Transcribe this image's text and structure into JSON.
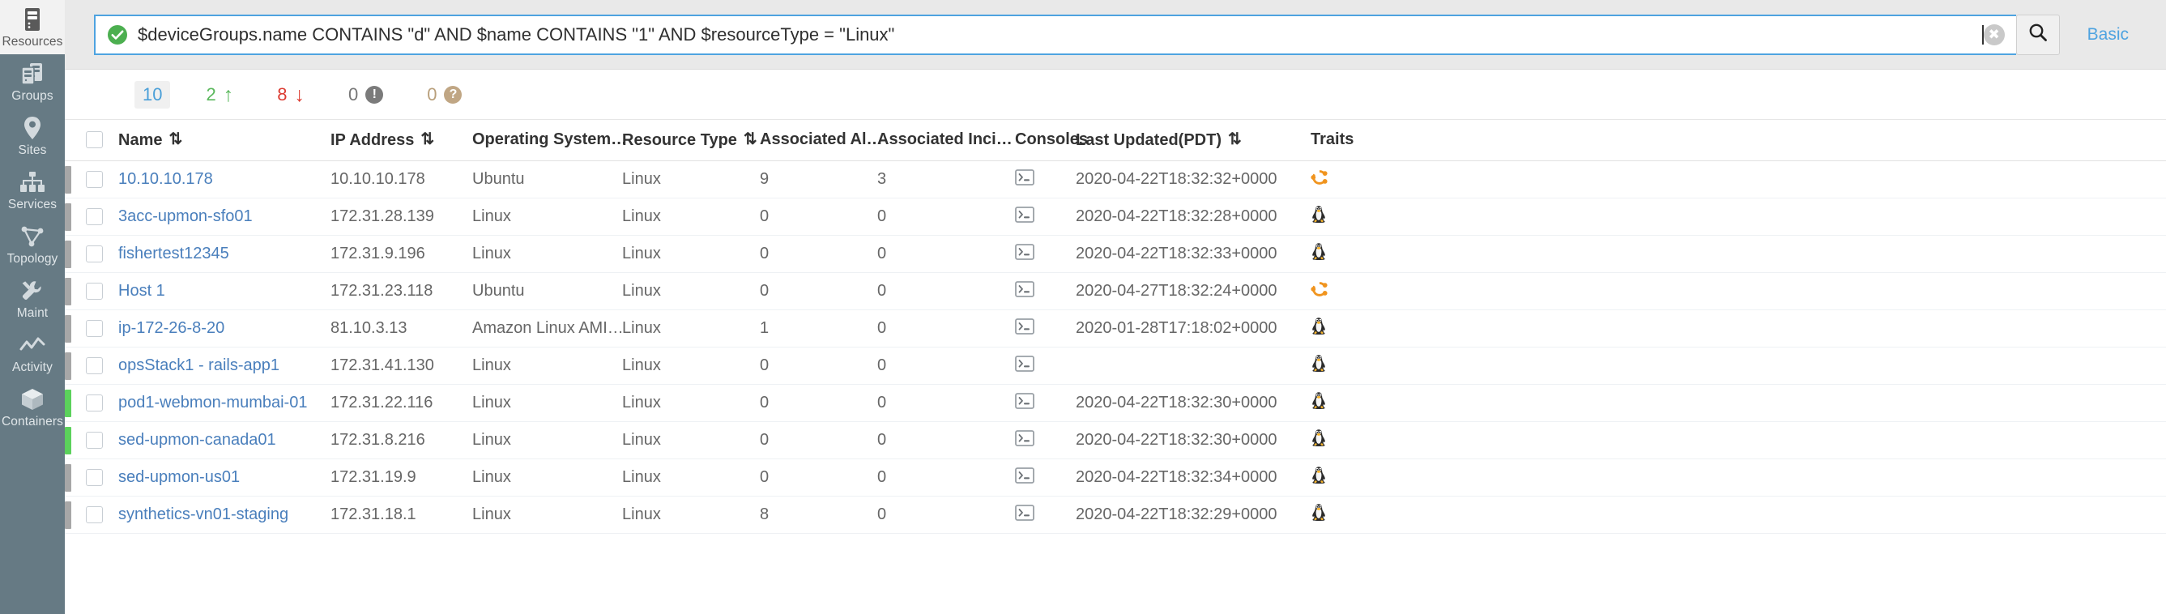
{
  "sidebar": {
    "items": [
      {
        "label": "Resources",
        "icon": "server-icon",
        "active": true
      },
      {
        "label": "Groups",
        "icon": "servers-icon",
        "active": false
      },
      {
        "label": "Sites",
        "icon": "map-pin-icon",
        "active": false
      },
      {
        "label": "Services",
        "icon": "hierarchy-icon",
        "active": false
      },
      {
        "label": "Topology",
        "icon": "topology-icon",
        "active": false
      },
      {
        "label": "Maint",
        "icon": "tools-icon",
        "active": false
      },
      {
        "label": "Activity",
        "icon": "activity-icon",
        "active": false
      },
      {
        "label": "Containers",
        "icon": "cube-icon",
        "active": false
      }
    ]
  },
  "search": {
    "query": "$deviceGroups.name CONTAINS \"d\" AND $name CONTAINS \"1\" AND $resourceType = \"Linux\"",
    "placeholder": "Search",
    "valid_icon": "green-check-icon",
    "clear_icon": "clear-x-icon",
    "search_icon": "search-icon",
    "mode_label": "Basic",
    "accent_color": "#4ea3e0"
  },
  "counters": [
    {
      "count": "10",
      "icon": "total-badge",
      "kind": "total",
      "color": "#4a9fd8"
    },
    {
      "count": "2",
      "icon": "arrow-up-icon",
      "kind": "up",
      "color": "#5ab85c"
    },
    {
      "count": "8",
      "icon": "arrow-down-icon",
      "kind": "down",
      "color": "#dc3c32"
    },
    {
      "count": "0",
      "icon": "info-badge-icon",
      "kind": "unknown",
      "color": "#7b7b7b"
    },
    {
      "count": "0",
      "icon": "question-badge-icon",
      "kind": "question",
      "color": "#c0a684"
    }
  ],
  "table": {
    "headers": [
      {
        "label": "Name",
        "sortable": true
      },
      {
        "label": "IP Address",
        "sortable": true
      },
      {
        "label": "Operating System…",
        "sortable": false
      },
      {
        "label": "Resource Type",
        "sortable": true
      },
      {
        "label": "Associated Al…",
        "sortable": false
      },
      {
        "label": "Associated Inci…",
        "sortable": false
      },
      {
        "label": "Consoles",
        "sortable": false
      },
      {
        "label": "Last Updated(PDT)",
        "sortable": true
      },
      {
        "label": "Traits",
        "sortable": false
      }
    ],
    "rows": [
      {
        "status": "gray",
        "name": "10.10.10.178",
        "ip": "10.10.10.178",
        "os": "Ubuntu",
        "resource_type": "Linux",
        "alerts": "9",
        "incidents": "3",
        "console": "terminal-icon",
        "updated": "2020-04-22T18:32:32+0000",
        "trait": "ubuntu-icon"
      },
      {
        "status": "gray",
        "name": "3acc-upmon-sfo01",
        "ip": "172.31.28.139",
        "os": "Linux",
        "resource_type": "Linux",
        "alerts": "0",
        "incidents": "0",
        "console": "terminal-icon",
        "updated": "2020-04-22T18:32:28+0000",
        "trait": "tux-icon"
      },
      {
        "status": "gray",
        "name": "fishertest12345",
        "ip": "172.31.9.196",
        "os": "Linux",
        "resource_type": "Linux",
        "alerts": "0",
        "incidents": "0",
        "console": "terminal-icon",
        "updated": "2020-04-22T18:32:33+0000",
        "trait": "tux-icon"
      },
      {
        "status": "gray",
        "name": "Host 1",
        "ip": "172.31.23.118",
        "os": "Ubuntu",
        "resource_type": "Linux",
        "alerts": "0",
        "incidents": "0",
        "console": "terminal-icon",
        "updated": "2020-04-27T18:32:24+0000",
        "trait": "ubuntu-icon"
      },
      {
        "status": "gray",
        "name": "ip-172-26-8-20",
        "ip": "81.10.3.13",
        "os": "Amazon Linux AMI…",
        "resource_type": "Linux",
        "alerts": "1",
        "incidents": "0",
        "console": "terminal-icon",
        "updated": "2020-01-28T17:18:02+0000",
        "trait": "tux-icon"
      },
      {
        "status": "gray",
        "name": "opsStack1 - rails-app1",
        "ip": "172.31.41.130",
        "os": "Linux",
        "resource_type": "Linux",
        "alerts": "0",
        "incidents": "0",
        "console": "terminal-icon",
        "updated": "",
        "trait": "tux-icon"
      },
      {
        "status": "green",
        "name": "pod1-webmon-mumbai-01",
        "ip": "172.31.22.116",
        "os": "Linux",
        "resource_type": "Linux",
        "alerts": "0",
        "incidents": "0",
        "console": "terminal-icon",
        "updated": "2020-04-22T18:32:30+0000",
        "trait": "tux-icon"
      },
      {
        "status": "green",
        "name": "sed-upmon-canada01",
        "ip": "172.31.8.216",
        "os": "Linux",
        "resource_type": "Linux",
        "alerts": "0",
        "incidents": "0",
        "console": "terminal-icon",
        "updated": "2020-04-22T18:32:30+0000",
        "trait": "tux-icon"
      },
      {
        "status": "gray",
        "name": "sed-upmon-us01",
        "ip": "172.31.19.9",
        "os": "Linux",
        "resource_type": "Linux",
        "alerts": "0",
        "incidents": "0",
        "console": "terminal-icon",
        "updated": "2020-04-22T18:32:34+0000",
        "trait": "tux-icon"
      },
      {
        "status": "gray",
        "name": "synthetics-vn01-staging",
        "ip": "172.31.18.1",
        "os": "Linux",
        "resource_type": "Linux",
        "alerts": "8",
        "incidents": "0",
        "console": "terminal-icon",
        "updated": "2020-04-22T18:32:29+0000",
        "trait": "tux-icon"
      }
    ]
  }
}
